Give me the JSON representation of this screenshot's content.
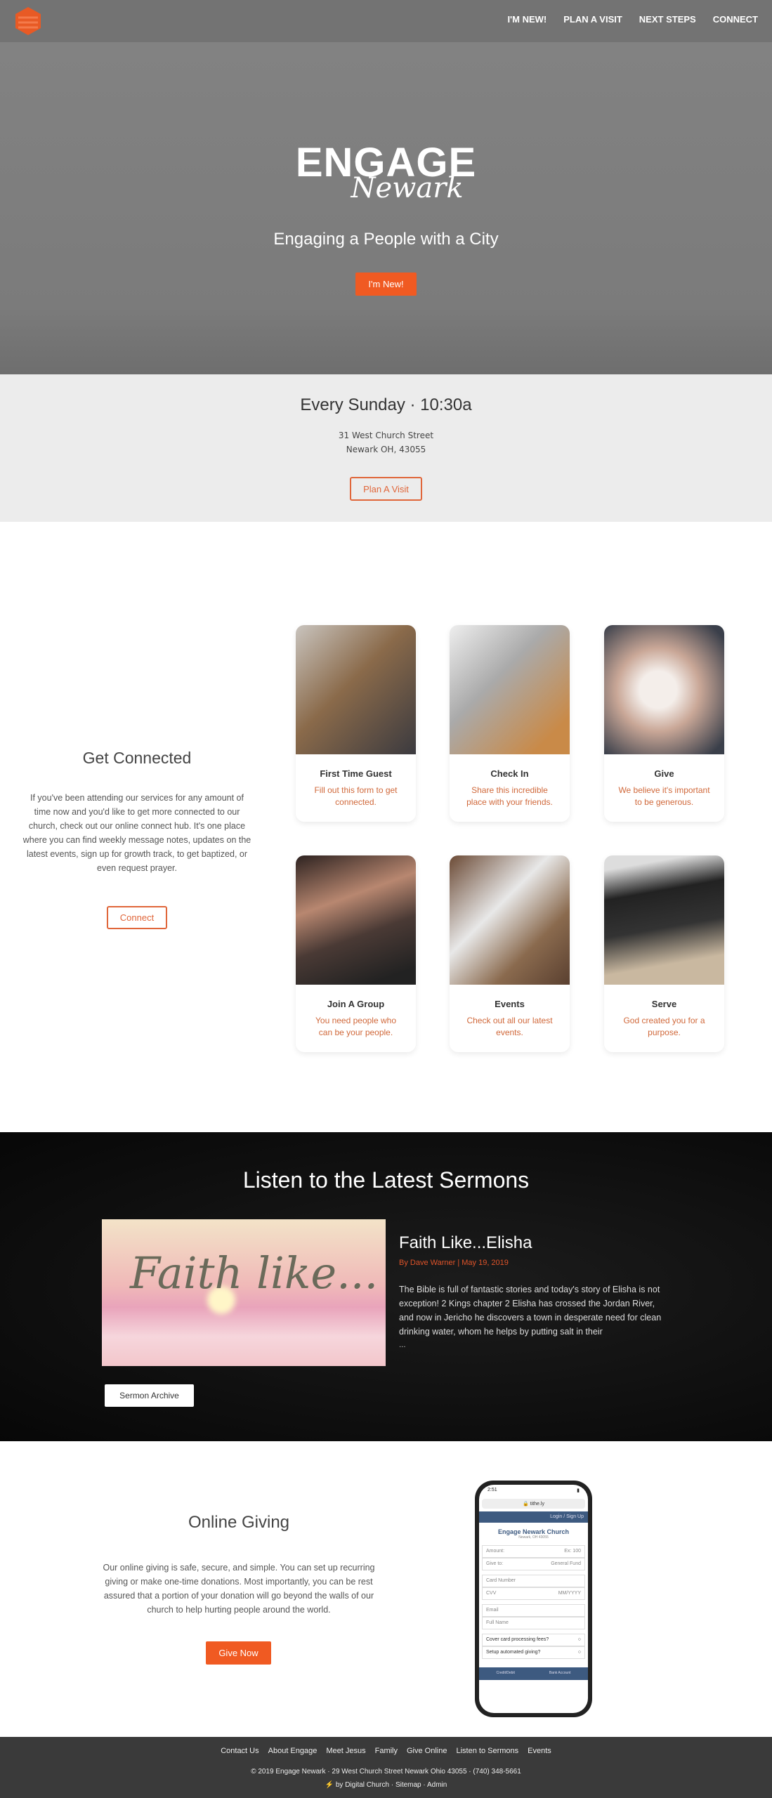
{
  "nav": {
    "logo": "Engage Newark hexagon logo",
    "items": [
      "I'M NEW!",
      "PLAN A VISIT",
      "NEXT STEPS",
      "CONNECT"
    ]
  },
  "hero": {
    "brand_main": "ENGAGE",
    "brand_script": "Newark",
    "tagline": "Engaging a People with a City",
    "button": "I'm New!"
  },
  "service": {
    "heading": "Every Sunday · 10:30a",
    "address_line1": "31 West Church Street",
    "address_line2": "Newark OH, 43055",
    "button": "Plan A Visit"
  },
  "connect": {
    "heading": "Get Connected",
    "body": "If you've been attending our services for any amount of time now and you'd like to get more connected to our church, check out our online connect hub. It's one place where you can find weekly message notes, updates on the latest events, sign up for growth track, to get baptized, or even request prayer.",
    "button": "Connect",
    "cards": [
      {
        "title": "First Time Guest",
        "desc": "Fill out this form to get connected."
      },
      {
        "title": "Check In",
        "desc": "Share this incredible place with your friends."
      },
      {
        "title": "Give",
        "desc": "We believe it's important to be generous."
      },
      {
        "title": "Join A Group",
        "desc": "You need people who can be your people."
      },
      {
        "title": "Events",
        "desc": "Check out all our latest events."
      },
      {
        "title": "Serve",
        "desc": "God created you for a purpose."
      }
    ]
  },
  "sermons": {
    "heading": "Listen to the Latest Sermons",
    "image_text": "Faith like...",
    "title": "Faith Like...Elisha",
    "meta": "By Dave Warner | May 19, 2019",
    "excerpt": "The Bible is full of fantastic stories and today's story of Elisha is not exception! 2 Kings chapter 2 Elisha has crossed the Jordan River, and now in Jericho he discovers a town in desperate need for clean drinking water, whom he helps by putting salt in their",
    "ellipsis": "...",
    "button": "Sermon Archive"
  },
  "giving": {
    "heading": "Online Giving",
    "body": "Our online giving is safe, secure, and simple. You can set up recurring giving or make one-time donations. Most importantly, you can be rest assured that a portion of your donation will go beyond the walls of our church to help hurting people around the world.",
    "button": "Give Now",
    "phone": {
      "time": "2:51",
      "url": "tithe.ly",
      "login": "Login / Sign Up",
      "church": "Engage Newark Church",
      "location": "Newark, OH 43055",
      "amount_label": "Amount:",
      "amount_placeholder": "Ex: 100",
      "giveto_label": "Give to:",
      "giveto_value": "General Fund",
      "card_number": "Card Number",
      "cvv": "CVV",
      "expiry": "MM/YYYY",
      "email": "Email",
      "full_name": "Full Name",
      "cover_fees": "Cover card processing fees?",
      "automated": "Setup automated giving?",
      "tab1": "Credit/Debit",
      "tab2": "Bank Account"
    }
  },
  "footer": {
    "links": [
      "Contact Us",
      "About Engage",
      "Meet Jesus",
      "Family",
      "Give Online",
      "Listen to Sermons",
      "Events"
    ],
    "copyright": "© 2019 Engage Newark · 29 West Church Street Newark Ohio 43055 · (740) 348-5661",
    "credit_prefix": "by Digital Church",
    "sitemap": "Sitemap",
    "admin": "Admin",
    "sep": "·"
  },
  "colors": {
    "accent": "#f05a22",
    "nav": "#737373",
    "footer": "#3a3a3a"
  }
}
